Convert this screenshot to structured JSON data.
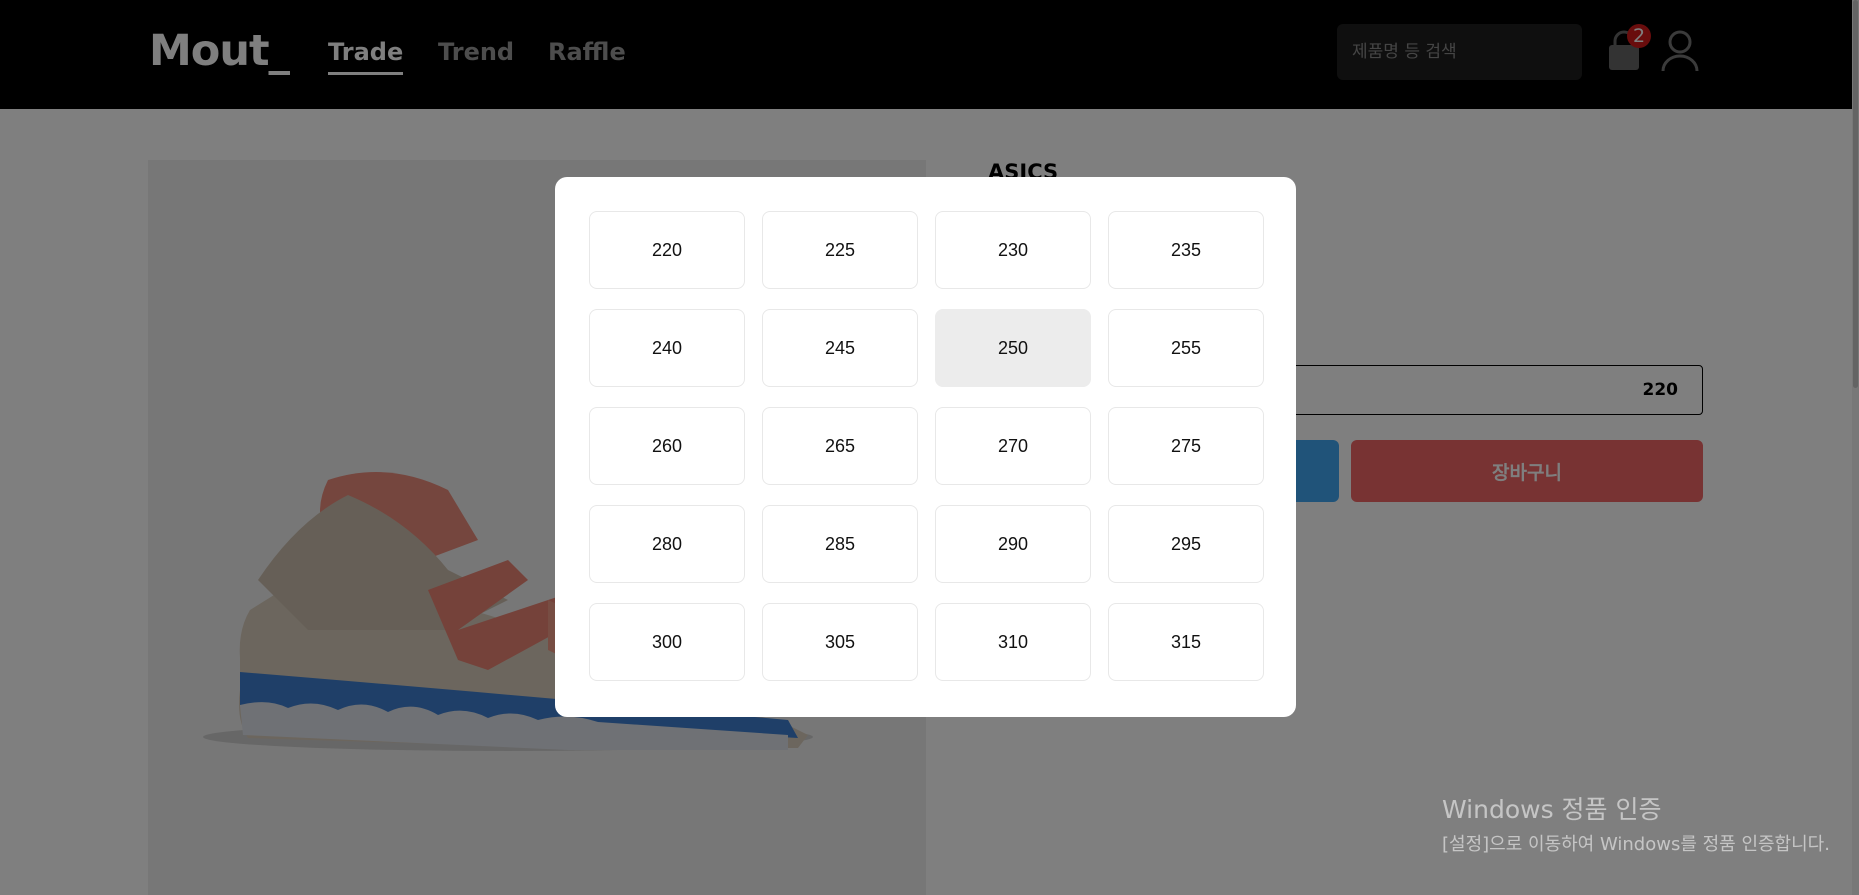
{
  "header": {
    "logo": "Mout_",
    "nav": [
      {
        "label": "Trade",
        "active": true
      },
      {
        "label": "Trend",
        "active": false
      },
      {
        "label": "Raffle",
        "active": false
      }
    ],
    "search": {
      "placeholder": "제품명 등 검색"
    },
    "cart_badge": "2",
    "icons": [
      "shopping-bag-icon",
      "user-icon"
    ]
  },
  "product": {
    "brand": "ASICS",
    "selected_size": "220",
    "cart_button_label": "장바구니"
  },
  "size_modal": {
    "selected": "250",
    "options": [
      "220",
      "225",
      "230",
      "235",
      "240",
      "245",
      "250",
      "255",
      "260",
      "265",
      "270",
      "275",
      "280",
      "285",
      "290",
      "295",
      "300",
      "305",
      "310",
      "315"
    ]
  },
  "watermark": {
    "title": "Windows 정품 인증",
    "subtitle": "[설정]으로 이동하여 Windows를 정품 인증합니다."
  },
  "colors": {
    "header_bg": "#000000",
    "buy_button": "#41a6f2",
    "cart_button": "#f06767",
    "badge": "#d21a1a",
    "selected_size_bg": "#ececec"
  }
}
